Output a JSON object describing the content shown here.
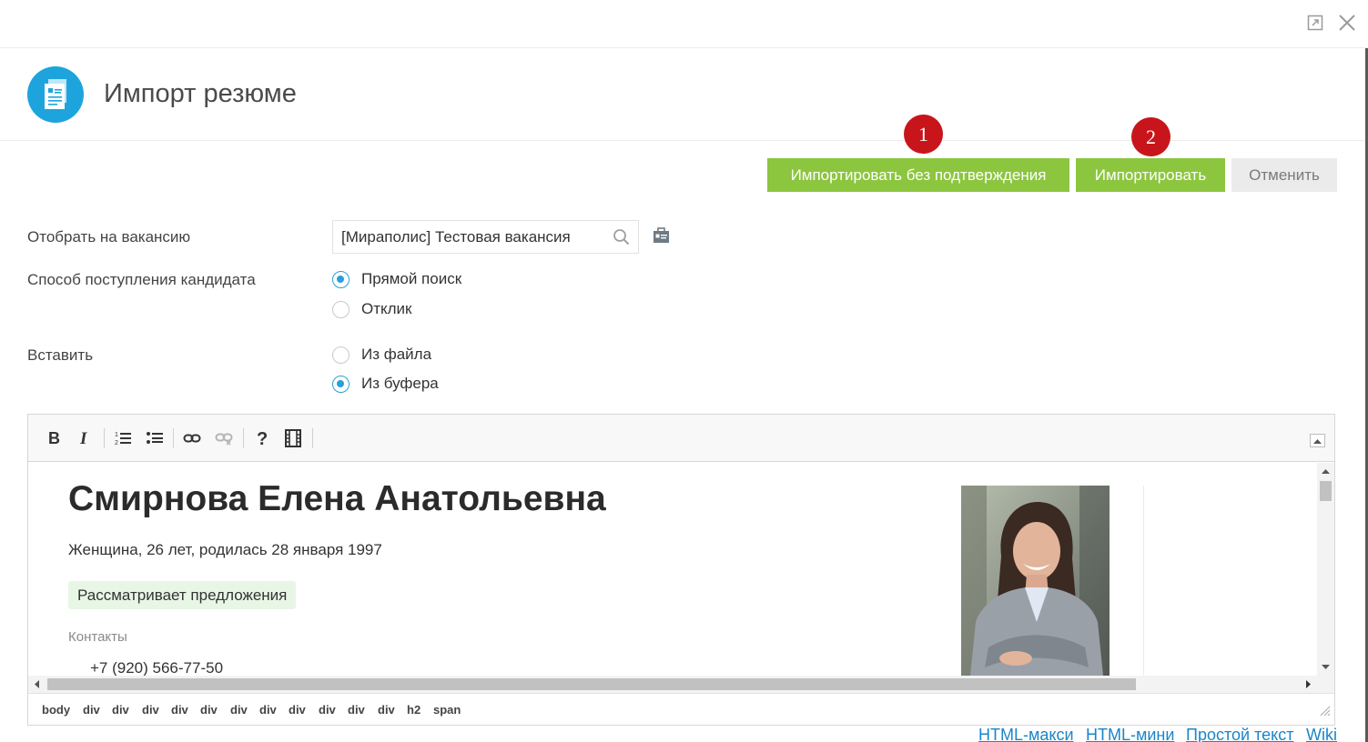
{
  "window": {
    "maximize_icon": "maximize-icon",
    "close_icon": "close-icon"
  },
  "header": {
    "title": "Импорт резюме",
    "logo_icon": "document-icon"
  },
  "actions": {
    "import_no_confirm": "Импортировать без подтверждения",
    "import": "Импортировать",
    "cancel": "Отменить",
    "badge_1": "1",
    "badge_2": "2",
    "accent_color": "#8cc63f",
    "badge_color": "#c8151b"
  },
  "form": {
    "vacancy": {
      "label": "Отобрать на вакансию",
      "value": "[Мираполис] Тестовая вакансия"
    },
    "source": {
      "label": "Способ поступления кандидата",
      "options": [
        {
          "label": "Прямой поиск",
          "selected": true
        },
        {
          "label": "Отклик",
          "selected": false
        }
      ]
    },
    "insert": {
      "label": "Вставить",
      "options": [
        {
          "label": "Из файла",
          "selected": false
        },
        {
          "label": "Из буфера",
          "selected": true
        }
      ]
    }
  },
  "editor": {
    "toolbar": [
      "bold-icon",
      "italic-icon",
      "ordered-list-icon",
      "bullet-list-icon",
      "link-icon",
      "unlink-icon",
      "help-icon",
      "video-icon"
    ],
    "resume": {
      "name": "Смирнова Елена Анатольевна",
      "info": "Женщина, 26 лет, родилась 28 января 1997",
      "status": "Рассматривает предложения",
      "contacts_label": "Контакты",
      "phone": "+7 (920) 566-77-50"
    },
    "breadcrumbs": [
      "body",
      "div",
      "div",
      "div",
      "div",
      "div",
      "div",
      "div",
      "div",
      "div",
      "div",
      "div",
      "h2",
      "span"
    ]
  },
  "modes": [
    "HTML-макси",
    "HTML-мини",
    "Простой текст",
    "Wiki"
  ]
}
